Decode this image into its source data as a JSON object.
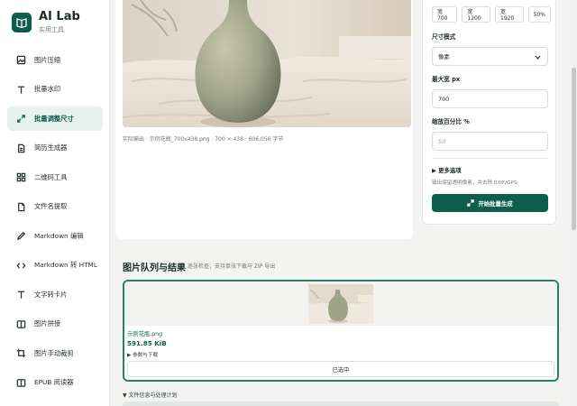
{
  "app": {
    "title": "AI Lab",
    "subtitle": "实用工具",
    "logo_icon": "book-icon",
    "accent": "#0e5e4b"
  },
  "sidebar": {
    "items": [
      {
        "label": "图片压缩",
        "icon": "image-icon",
        "active": false
      },
      {
        "label": "批量水印",
        "icon": "text-t-icon",
        "active": false
      },
      {
        "label": "批量调整尺寸",
        "icon": "resize-arrows-icon",
        "active": true
      },
      {
        "label": "简历生成器",
        "icon": "document-icon",
        "active": false
      },
      {
        "label": "二维码工具",
        "icon": "grid-icon",
        "active": false
      },
      {
        "label": "文件名提取",
        "icon": "file-icon",
        "active": false
      },
      {
        "label": "Markdown 编辑",
        "icon": "pen-icon",
        "active": false
      },
      {
        "label": "Markdown 转 HTML",
        "icon": "code-icon",
        "active": false
      },
      {
        "label": "文字转卡片",
        "icon": "text-t-icon",
        "active": false
      },
      {
        "label": "图片拼接",
        "icon": "book-open-icon",
        "active": false
      },
      {
        "label": "图片手动裁剪",
        "icon": "crop-icon",
        "active": false
      },
      {
        "label": "EPUB 阅读器",
        "icon": "book-open-icon",
        "active": false
      }
    ]
  },
  "preview": {
    "caption": "实际输出 · 示例花瓶_700x438.png · 700 × 438 · 606,056 字节"
  },
  "settings": {
    "presets": [
      "宽 700",
      "宽 1200",
      "宽 1920",
      "50%"
    ],
    "size_mode_label": "尺寸模式",
    "size_mode_value": "像素",
    "max_width_label": "最大宽 px",
    "max_width_value": "700",
    "scale_label": "缩放百分比 %",
    "scale_placeholder": "50",
    "more_options": "▶ 更多选项",
    "more_note": "输出保留透明像素，并去除 EXIF/GPS。",
    "generate_button": "开始批量生成"
  },
  "queue": {
    "title": "图片队列与结果",
    "subtitle": "逐张检查，支持单张下载与 ZIP 导出",
    "items": [
      {
        "file_name": "示例花瓶.png",
        "size": "591.85 KiB",
        "action": "▶ 参数与下载",
        "status": "已选中"
      }
    ],
    "details_toggle": "▼ 文件信息与处理计划"
  }
}
